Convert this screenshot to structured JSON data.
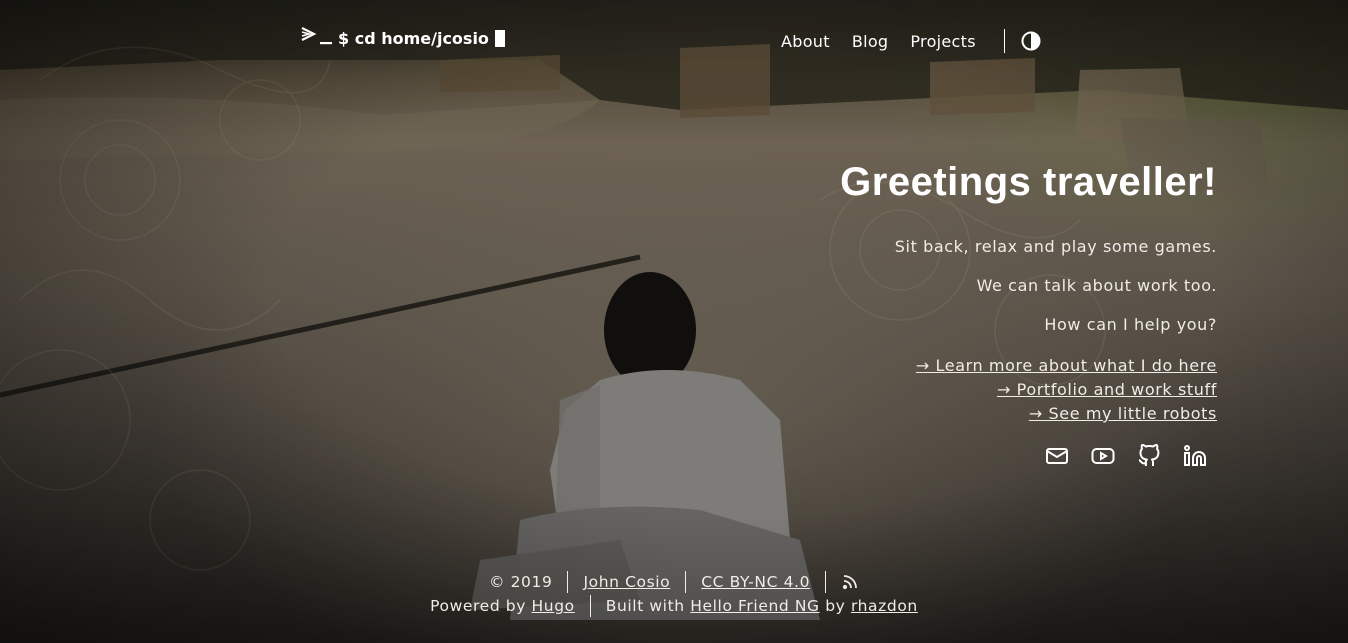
{
  "header": {
    "logo_text": "$ cd home/jcosio",
    "nav": [
      "About",
      "Blog",
      "Projects"
    ],
    "theme_toggle_icon": "contrast-icon"
  },
  "hero": {
    "title": "Greetings traveller!",
    "lines": [
      "Sit back, relax and play some games.",
      "We can talk about work too.",
      "How can I help you?"
    ],
    "links": [
      "→ Learn more about what I do here",
      "→ Portfolio and work stuff",
      "→ See my little robots"
    ],
    "social_icons": [
      "mail-icon",
      "youtube-icon",
      "github-icon",
      "linkedin-icon"
    ]
  },
  "footer": {
    "copyright": "© 2019",
    "author": "John Cosio",
    "license": "CC BY-NC 4.0",
    "rss_icon": "rss-icon",
    "powered_prefix": "Powered by",
    "powered_link": "Hugo",
    "built_prefix": "Built with",
    "theme_link": "Hello Friend NG",
    "by_text": "by",
    "theme_author": "rhazdon"
  },
  "colors": {
    "text": "#f0ece6",
    "heading": "#ffffff"
  }
}
